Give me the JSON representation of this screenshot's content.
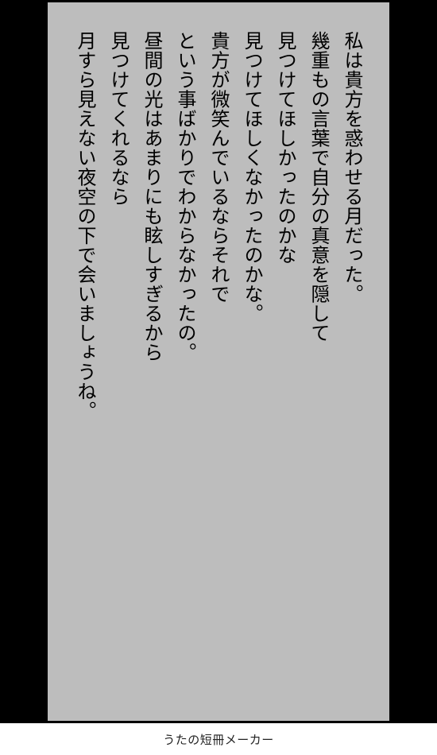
{
  "poem": {
    "lines": [
      "私は貴方を惑わせる月だった。",
      "幾重もの言葉で自分の真意を隠して",
      "見つけてほしかったのかな",
      "見つけてほしくなかったのかな。",
      "貴方が微笑んでいるならそれで",
      "という事ばかりでわからなかったの。",
      "昼間の光はあまりにも眩しすぎるから",
      "見つけてくれるなら",
      "月すら見えない夜空の下で会いましょうね。"
    ]
  },
  "footer": {
    "label": "うたの短冊メーカー"
  },
  "colors": {
    "frame": "#000000",
    "card": "#bdbdbd",
    "text": "#000000"
  }
}
